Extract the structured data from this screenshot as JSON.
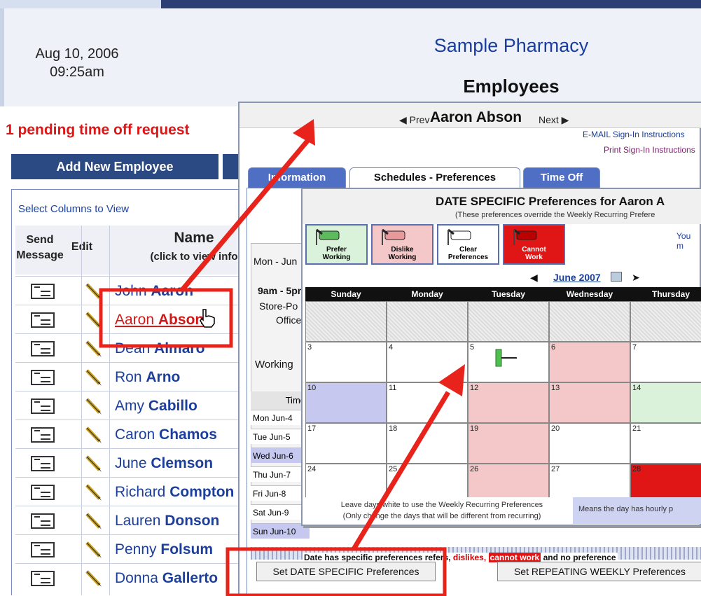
{
  "app": {
    "date": "Aug 10, 2006",
    "time": "09:25am",
    "pharmacy": "Sample Pharmacy",
    "page_title": "Employees",
    "pending_notice": "1 pending time off request",
    "add_employee_label": "Add New Employee",
    "select_columns_label": "Select Columns to View"
  },
  "employee_table": {
    "headers": {
      "send": "Send",
      "message": "Message",
      "edit": "Edit",
      "name": "Name",
      "name_hint": "(click to view info"
    },
    "rows": [
      {
        "first": "John",
        "last": "Aaron"
      },
      {
        "first": "Aaron",
        "last": "Abson"
      },
      {
        "first": "Dean",
        "last": "Almaro"
      },
      {
        "first": "Ron",
        "last": "Arno"
      },
      {
        "first": "Amy",
        "last": "Cabillo"
      },
      {
        "first": "Caron",
        "last": "Chamos"
      },
      {
        "first": "June",
        "last": "Clemson"
      },
      {
        "first": "Richard",
        "last": "Compton"
      },
      {
        "first": "Lauren",
        "last": "Donson"
      },
      {
        "first": "Penny",
        "last": "Folsum"
      },
      {
        "first": "Donna",
        "last": "Gallerto"
      }
    ]
  },
  "employee_popup": {
    "prev_label": "◀ Prev",
    "employee_name": "Aaron Abson",
    "next_label": "Next ▶",
    "email_instructions": "E-MAIL Sign-In Instructions",
    "print_instructions": "Print Sign-In Instructions",
    "tabs": [
      "Information",
      "Schedules - Preferences",
      "Time Off"
    ],
    "shift_day": "Mon - Jun",
    "shift_time": "9am - 5pm",
    "shift_location": "Store-Po",
    "shift_office": "Office",
    "working_label": "Working",
    "time_header": "Time",
    "day_rows": [
      {
        "label": "Mon Jun-4",
        "color": "#ffffff"
      },
      {
        "label": "Tue Jun-5",
        "color": "#ffffff"
      },
      {
        "label": "Wed Jun-6",
        "color": "#c6c8f0"
      },
      {
        "label": "Thu Jun-7",
        "color": "#ffffff"
      },
      {
        "label": "Fri Jun-8",
        "color": "#ffffff"
      },
      {
        "label": "Sat Jun-9",
        "color": "#ffffff"
      },
      {
        "label": "Sun Jun-10",
        "color": "#c6c8f0"
      }
    ],
    "legend": {
      "prefix": "Date has specific preferences",
      "prefers": "refers,",
      "dislikes": "dislikes,",
      "cannot_work": "cannot work",
      "suffix": "and no preference"
    },
    "set_date_button": "Set DATE SPECIFIC Preferences",
    "set_weekly_button": "Set REPEATING WEEKLY Preferences"
  },
  "date_popup": {
    "title": "DATE SPECIFIC Preferences for Aaron A",
    "subtitle": "(These preferences override the Weekly Recurring Prefere",
    "side_note": "You m",
    "pref_buttons": [
      {
        "line1": "Prefer",
        "line2": "Working"
      },
      {
        "line1": "Dislike",
        "line2": "Working"
      },
      {
        "line1": "Clear",
        "line2": "Preferences"
      },
      {
        "line1": "Cannot",
        "line2": "Work"
      }
    ],
    "month_label": "June 2007",
    "prev_arrow": "◀",
    "next_arrow": "➤",
    "weekdays": [
      "Sunday",
      "Monday",
      "Tuesday",
      "Wednesday",
      "Thursday"
    ],
    "weeks": [
      [
        {
          "d": "",
          "s": "gray"
        },
        {
          "d": "",
          "s": "gray"
        },
        {
          "d": "",
          "s": "gray"
        },
        {
          "d": "",
          "s": "gray"
        },
        {
          "d": "",
          "s": "gray"
        }
      ],
      [
        {
          "d": "3",
          "s": "none"
        },
        {
          "d": "4",
          "s": "none"
        },
        {
          "d": "5",
          "s": "none"
        },
        {
          "d": "6",
          "s": "dislike"
        },
        {
          "d": "7",
          "s": "none"
        }
      ],
      [
        {
          "d": "10",
          "s": "hourly"
        },
        {
          "d": "11",
          "s": "none"
        },
        {
          "d": "12",
          "s": "dislike"
        },
        {
          "d": "13",
          "s": "dislike"
        },
        {
          "d": "14",
          "s": "prefer"
        }
      ],
      [
        {
          "d": "17",
          "s": "none"
        },
        {
          "d": "18",
          "s": "none"
        },
        {
          "d": "19",
          "s": "dislike"
        },
        {
          "d": "20",
          "s": "none"
        },
        {
          "d": "21",
          "s": "none"
        }
      ],
      [
        {
          "d": "24",
          "s": "none"
        },
        {
          "d": "25",
          "s": "none"
        },
        {
          "d": "26",
          "s": "dislike"
        },
        {
          "d": "27",
          "s": "none"
        },
        {
          "d": "28",
          "s": "cannot"
        }
      ]
    ],
    "footer_left_1": "Leave days white to use the Weekly Recurring Preferences",
    "footer_left_2": "(Only change the days that will be different from recurring)",
    "footer_right": "Means the day has hourly p"
  },
  "colors": {
    "brand_blue": "#1c3f9c",
    "nav_bar": "#2b4a84",
    "pending_red": "#e01515",
    "prefer_green": "#d9f2d9",
    "dislike_red": "#f4c8c8",
    "cannot_red": "#e01515",
    "hourly_blue": "#c6c8f0",
    "annotation_red": "#e8231b"
  }
}
